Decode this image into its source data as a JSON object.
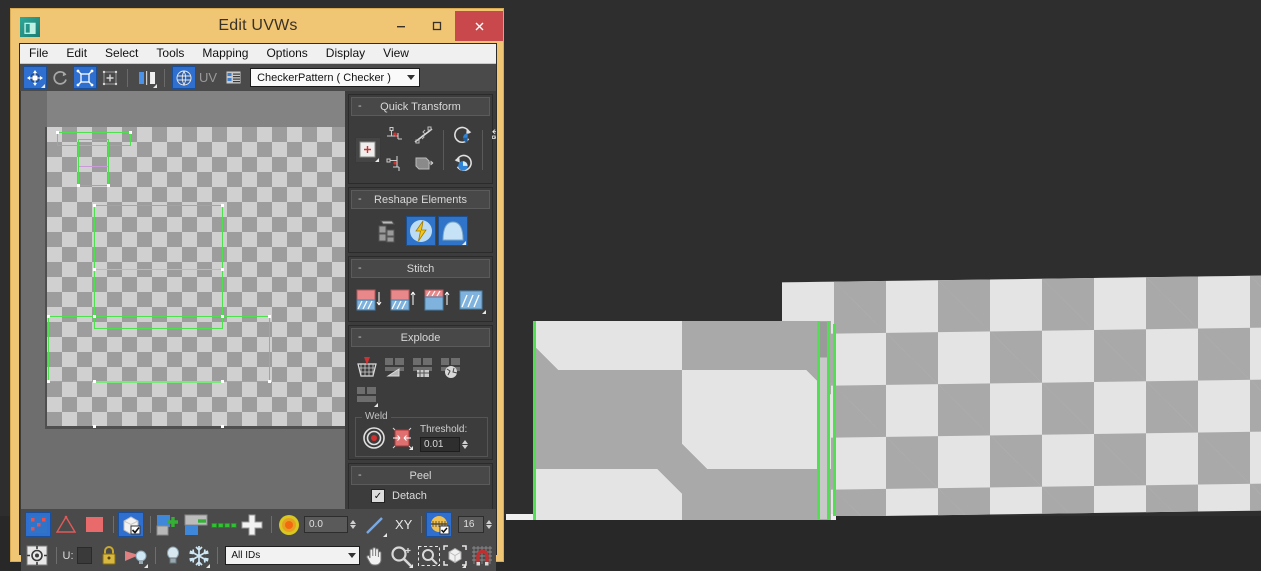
{
  "window": {
    "title": "Edit UVWs",
    "app_icon": "max-logo-icon",
    "minimize_label": "–",
    "maximize_label": "□",
    "close_label": "×"
  },
  "menubar": {
    "items": [
      "File",
      "Edit",
      "Select",
      "Tools",
      "Mapping",
      "Options",
      "Display",
      "View"
    ]
  },
  "toolbar": {
    "buttons": [
      {
        "name": "move-tool",
        "active": true
      },
      {
        "name": "rotate-tool",
        "active": false
      },
      {
        "name": "scale-tool",
        "active": true
      },
      {
        "name": "freeform-mode",
        "active": false
      },
      {
        "name": "mirror-tool",
        "active": false
      },
      {
        "name": "show-map-toggle",
        "active": true
      }
    ],
    "uv_label": "UV",
    "material_dropdown": "CheckerPattern  ( Checker )"
  },
  "rollouts": [
    {
      "title": "Quick Transform",
      "collapse_sign": "-",
      "tools": [
        "move-to-corner",
        "align-pivot-h",
        "align-pivot-v",
        "straighten-selection",
        "rotate-90-ccw",
        "rotate-90-cw",
        "space-horizontal",
        "space-vertical",
        "flip-horizontal"
      ]
    },
    {
      "title": "Reshape Elements",
      "collapse_sign": "-",
      "tools": [
        "quick-planar-map",
        "pelt-map",
        "relax-tool"
      ]
    },
    {
      "title": "Stitch",
      "collapse_sign": "-",
      "tools": [
        "stitch-source",
        "stitch-target",
        "stitch-custom",
        "stitch-diagonal"
      ]
    },
    {
      "title": "Explode",
      "collapse_sign": "-",
      "tools": [
        "break-apart",
        "explode-by-angle",
        "explode-by-material",
        "explode-by-smoothing",
        "explode-by-polygon",
        "explode-custom"
      ],
      "weld": {
        "legend": "Weld",
        "tools": [
          "target-weld",
          "weld-selected"
        ],
        "threshold_label": "Threshold:",
        "threshold_value": "0.01"
      }
    },
    {
      "title": "Peel",
      "collapse_sign": "-",
      "detach_label": "Detach",
      "detach_checked": "✓",
      "tools": [
        "peel-mode",
        "quick-peel",
        "reset-peel"
      ]
    }
  ],
  "bottom_toolbar": {
    "buttons": [
      {
        "name": "vertex-subobject",
        "active": true
      },
      {
        "name": "edge-subobject",
        "active": false
      },
      {
        "name": "face-subobject",
        "active": false
      },
      {
        "name": "element-subobject",
        "active": true
      },
      {
        "name": "grow-selection",
        "active": false
      },
      {
        "name": "shrink-selection",
        "active": false
      },
      {
        "name": "loop-uv",
        "active": false
      },
      {
        "name": "ring-uv",
        "active": false
      }
    ],
    "soft_selection_icon": "soft-selection-falloff-icon",
    "falloff_value": "0.0",
    "axis_label": "XY",
    "grid_snap_active": true,
    "grid_value": "16"
  },
  "status_bar": {
    "pivot_icon": "transform-center-icon",
    "u_label": "U:",
    "u_value": "",
    "lock_icon": "lock-icon",
    "light_icon": "light-cone-icon",
    "bulb_icon": "light-bulb-icon",
    "freeze_icon": "snowflake-icon",
    "material_ids": "All IDs",
    "nav_tools": [
      "pan-icon",
      "zoom-icon",
      "zoom-region-icon",
      "zoom-extents-icon",
      "snap-magnet-icon"
    ]
  },
  "uv_canvas": {
    "texture": "checker-pattern",
    "selection_color": "#4ee04e",
    "vertex_color": "#ffffff"
  },
  "viewport": {
    "background": "#2e2e2e",
    "selected_edge_color": "#52e052",
    "objects": [
      "box-with-checker-texture",
      "plane-with-checker-texture"
    ]
  }
}
